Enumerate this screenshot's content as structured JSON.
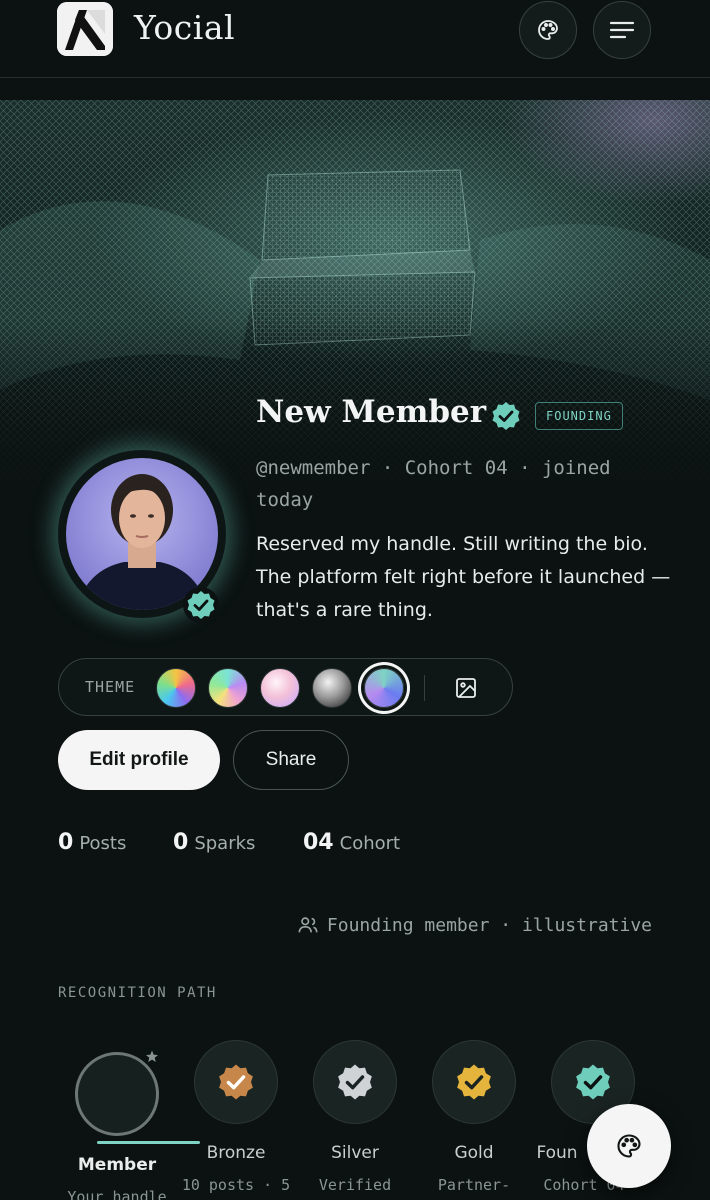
{
  "app": {
    "brand": "Yocial"
  },
  "profile": {
    "name": "New Member",
    "tag": "FOUNDING",
    "meta": "@newmember · Cohort 04 · joined today",
    "bio": "Reserved my handle. Still writing the bio. The platform felt right before it launched — that's a rare thing."
  },
  "theme": {
    "label": "THEME",
    "selected_index": 4
  },
  "actions": {
    "edit_label": "Edit profile",
    "share_label": "Share"
  },
  "stats": [
    {
      "value": "0",
      "label": "Posts"
    },
    {
      "value": "0",
      "label": "Sparks"
    },
    {
      "value": "04",
      "label": "Cohort"
    }
  ],
  "founding_line": "Founding member · illustrative",
  "recognition": {
    "label": "RECOGNITION PATH",
    "tiers": [
      {
        "name": "Member",
        "sub": "Your handle",
        "icon": "star-icon",
        "color": "#6d7775"
      },
      {
        "name": "Bronze",
        "sub": "10 posts · 5",
        "icon": "bronze-check-badge-icon",
        "color": "#c8874a"
      },
      {
        "name": "Silver",
        "sub": "Verified",
        "icon": "silver-check-badge-icon",
        "color": "#cfd3d6"
      },
      {
        "name": "Gold",
        "sub": "Partner-",
        "icon": "gold-check-badge-icon",
        "color": "#e5b43c"
      },
      {
        "name": "Foun",
        "sub": "Cohort 04 ·",
        "icon": "founding-check-badge-icon",
        "color": "#6fcdbb"
      }
    ]
  },
  "colors": {
    "accent": "#7fd3c4",
    "background": "#0b1211"
  }
}
